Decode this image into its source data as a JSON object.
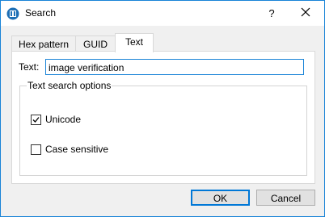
{
  "window": {
    "title": "Search",
    "help_glyph": "?",
    "icon": "app-icon",
    "close_icon": "close-icon"
  },
  "tabs": [
    {
      "label": "Hex pattern",
      "active": false
    },
    {
      "label": "GUID",
      "active": false
    },
    {
      "label": "Text",
      "active": true
    }
  ],
  "text_panel": {
    "text_label": "Text:",
    "text_value": "image verification",
    "options_group_title": "Text search options",
    "options": [
      {
        "label": "Unicode",
        "checked": true
      },
      {
        "label": "Case sensitive",
        "checked": false
      }
    ]
  },
  "buttons": {
    "ok_label": "OK",
    "cancel_label": "Cancel"
  },
  "colors": {
    "accent": "#1883d7",
    "panel_bg": "#ffffff",
    "dialog_bg": "#f0f0f0"
  }
}
